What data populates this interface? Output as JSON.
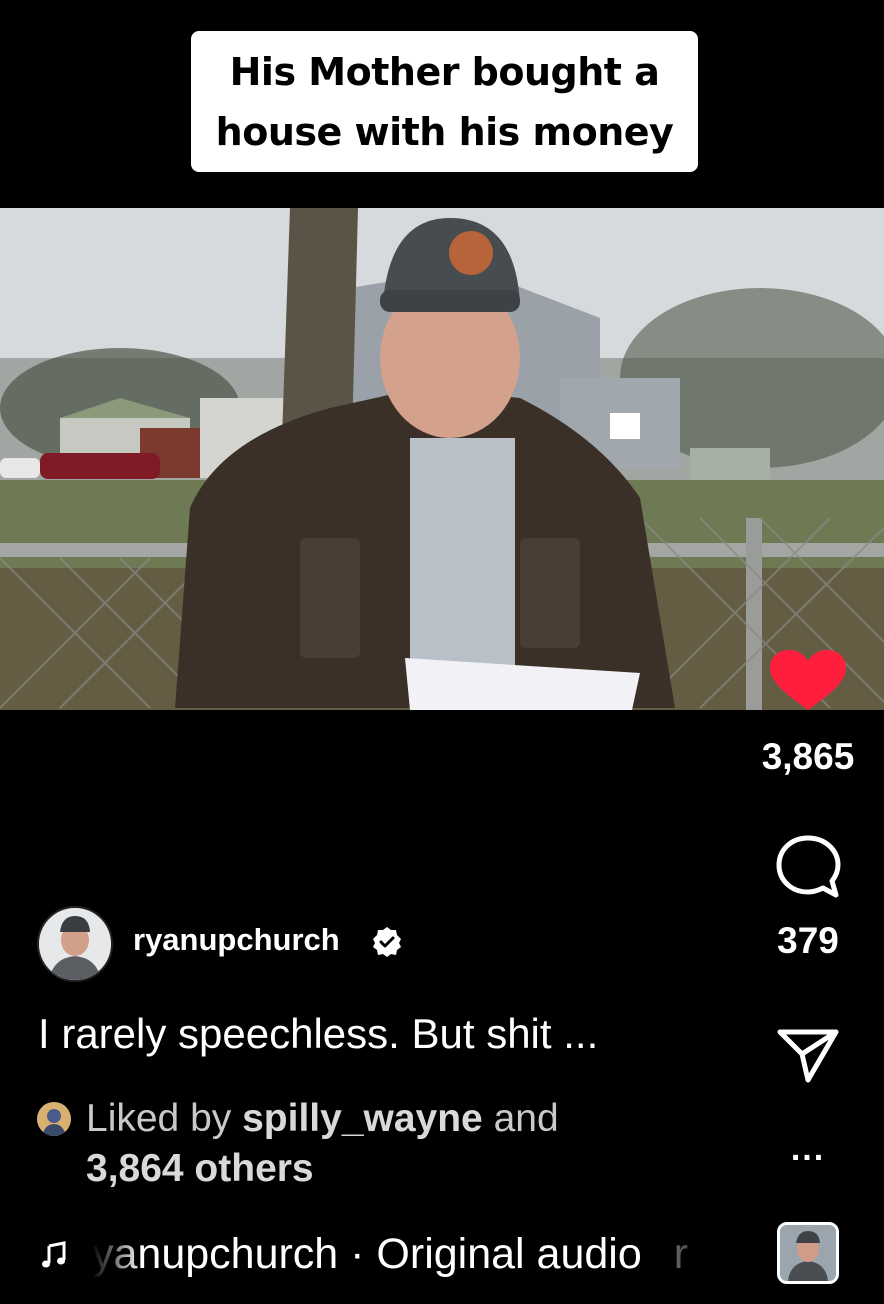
{
  "overlay_caption": {
    "line1": "His Mother bought a",
    "line2": "house with his money"
  },
  "actions": {
    "like_count": "3,865",
    "comment_count": "379",
    "more_label": "..."
  },
  "post": {
    "username": "ryanupchurch",
    "description": "I rarely speechless. But shit ...",
    "liked_by_prefix": "Liked by",
    "liked_by_user": "spilly_wayne",
    "liked_by_and": "and",
    "liked_by_others": "3,864 others"
  },
  "audio": {
    "label": "yanupchurch · Original audio",
    "trailing": "r"
  },
  "icons": {
    "like": "heart-icon",
    "comment": "comment-bubble-icon",
    "share": "paper-plane-icon",
    "more": "more-dots-icon",
    "verified": "verified-badge-icon",
    "music": "music-note-icon"
  },
  "colors": {
    "like_red": "#ff1f3d",
    "background": "#000000",
    "caption_bg": "#ffffff"
  }
}
